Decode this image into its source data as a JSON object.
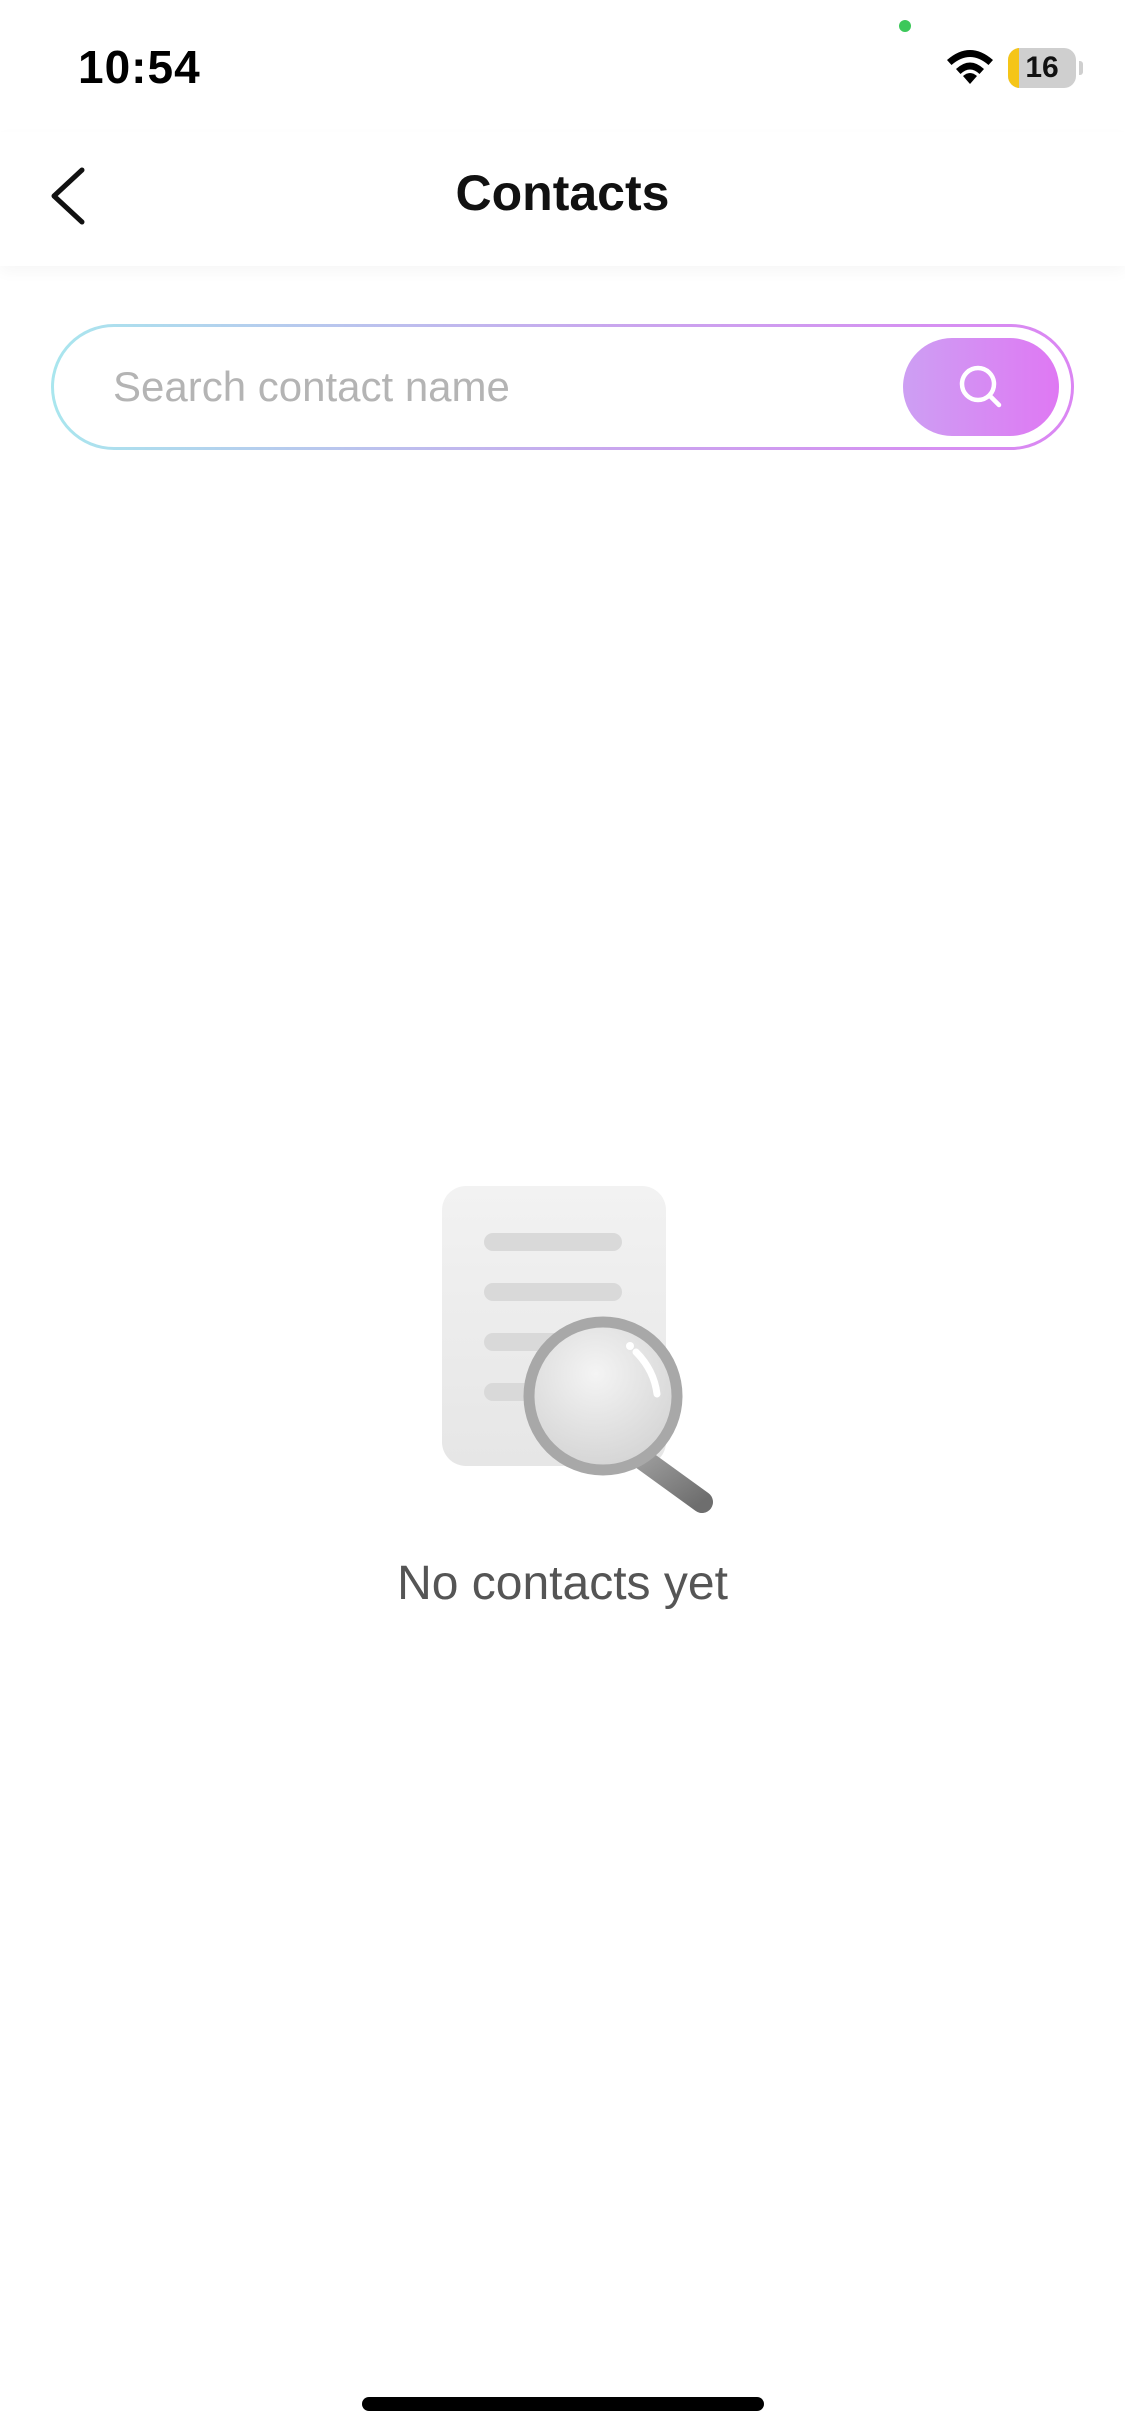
{
  "status_bar": {
    "time": "10:54",
    "battery_level": "16",
    "battery_fraction": 0.16,
    "battery_color": "#f5c518",
    "privacy_indicator_color": "#3cc85a"
  },
  "nav": {
    "title": "Contacts",
    "back_icon": "chevron-left-icon"
  },
  "search": {
    "placeholder": "Search contact name",
    "value": "",
    "button_icon": "search-icon",
    "accent_gradient": [
      "#cd9ff3",
      "#df78f3"
    ],
    "border_gradient": [
      "#a9e6ee",
      "#c9a6ee",
      "#db86f3"
    ]
  },
  "empty_state": {
    "icon": "document-search-icon",
    "message": "No contacts yet"
  }
}
